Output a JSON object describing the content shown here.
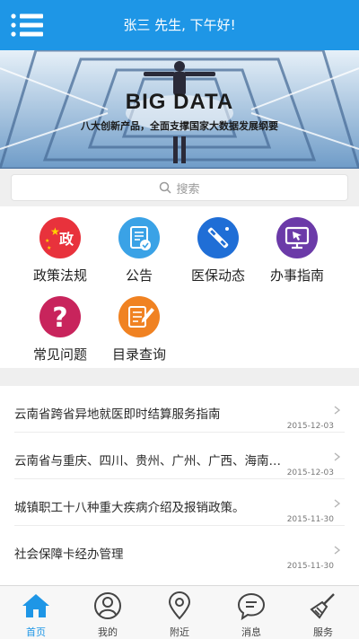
{
  "header": {
    "greeting": "张三 先生, 下午好!"
  },
  "banner": {
    "title": "BIG DATA",
    "subtitle": "八大创新产品，全面支撑国家大数据发展纲要"
  },
  "search": {
    "placeholder": "搜索"
  },
  "grid": {
    "items": [
      {
        "label": "政策法规",
        "icon": "policy-flag-icon",
        "color": "#e8323c"
      },
      {
        "label": "公告",
        "icon": "announcement-icon",
        "color": "#3aa2e6"
      },
      {
        "label": "医保动态",
        "icon": "medical-tools-icon",
        "color": "#1f6ed6"
      },
      {
        "label": "办事指南",
        "icon": "guide-monitor-icon",
        "color": "#6b3aa8"
      },
      {
        "label": "常见问题",
        "icon": "question-icon",
        "color": "#c8245c"
      },
      {
        "label": "目录查询",
        "icon": "catalog-edit-icon",
        "color": "#f08222"
      }
    ]
  },
  "news": {
    "items": [
      {
        "title": "云南省跨省异地就医即时结算服务指南",
        "date": "2015-12-03"
      },
      {
        "title": "云南省与重庆、四川、贵州、广州、广西、海南…",
        "date": "2015-12-03"
      },
      {
        "title": "城镇职工十八种重大疾病介绍及报销政策。",
        "date": "2015-11-30"
      },
      {
        "title": "社会保障卡经办管理",
        "date": "2015-11-30"
      }
    ]
  },
  "tabbar": {
    "items": [
      {
        "label": "首页",
        "icon": "home-icon",
        "active": true
      },
      {
        "label": "我的",
        "icon": "user-icon",
        "active": false
      },
      {
        "label": "附近",
        "icon": "location-pin-icon",
        "active": false
      },
      {
        "label": "消息",
        "icon": "message-icon",
        "active": false
      },
      {
        "label": "服务",
        "icon": "broom-icon",
        "active": false
      }
    ],
    "active_color": "#1e96e6"
  }
}
